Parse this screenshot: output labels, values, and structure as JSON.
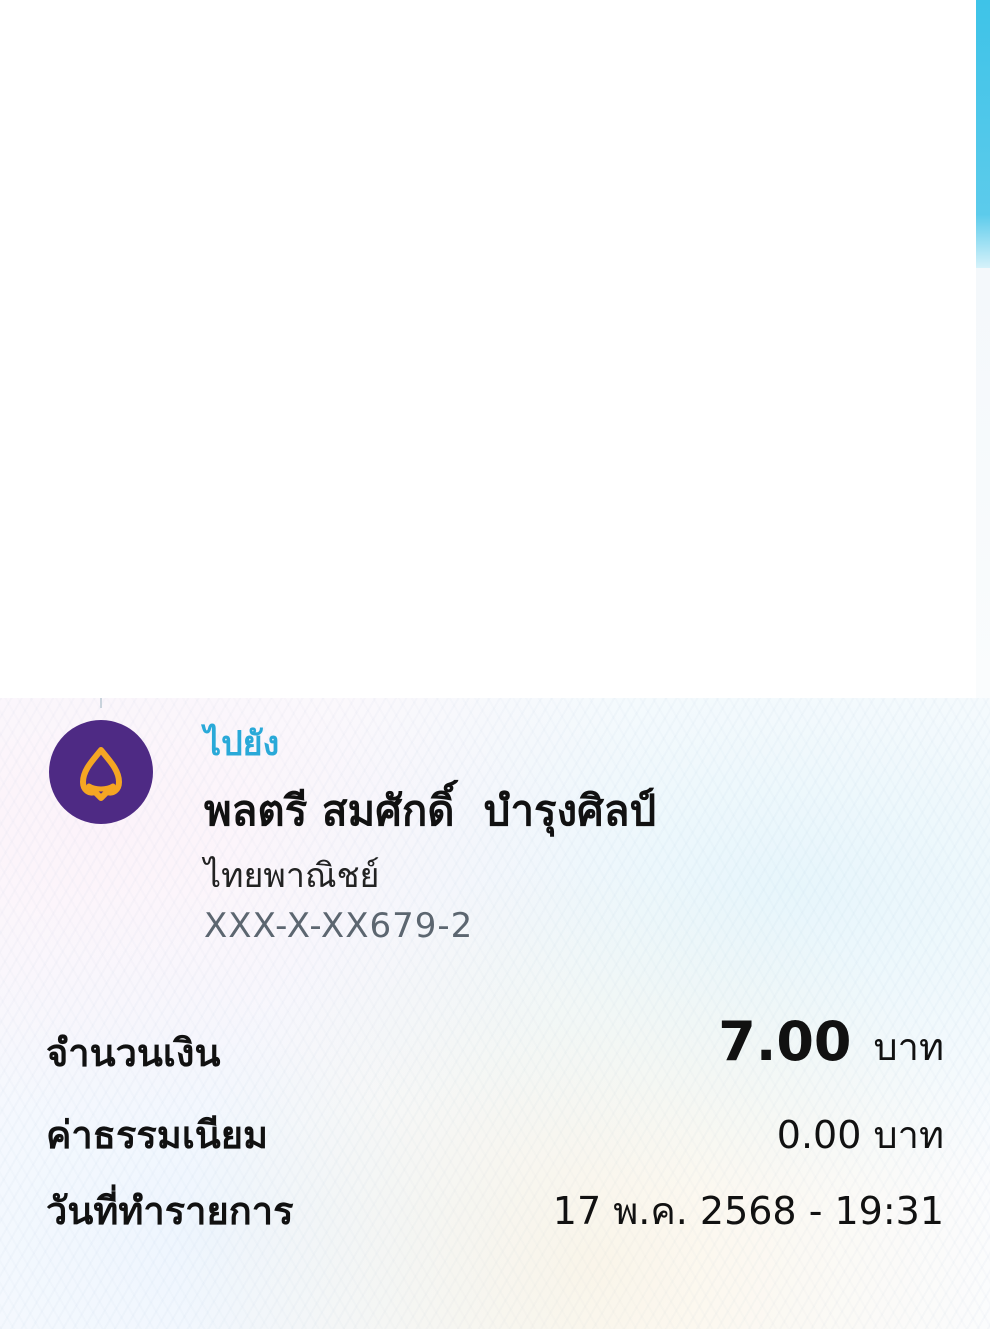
{
  "recipient": {
    "to_label": "ไปยัง",
    "name": "พลตรี สมศักดิ์  บำรุงศิลป์",
    "bank": "ไทยพาณิชย์",
    "account": "XXX-X-XX679-2",
    "bank_logo_icon": "scb-bank-logo-icon",
    "bank_color": "#4e2a84"
  },
  "details": {
    "amount": {
      "label": "จำนวนเงิน",
      "value": "7.00",
      "unit": "บาท"
    },
    "fee": {
      "label": "ค่าธรรมเนียม",
      "value": "0.00 บาท"
    },
    "datetime": {
      "label": "วันที่ทำรายการ",
      "value": "17 พ.ค. 2568 - 19:31"
    }
  },
  "colors": {
    "accent": "#29a9d8",
    "scroll_accent": "#3ec3e8"
  }
}
